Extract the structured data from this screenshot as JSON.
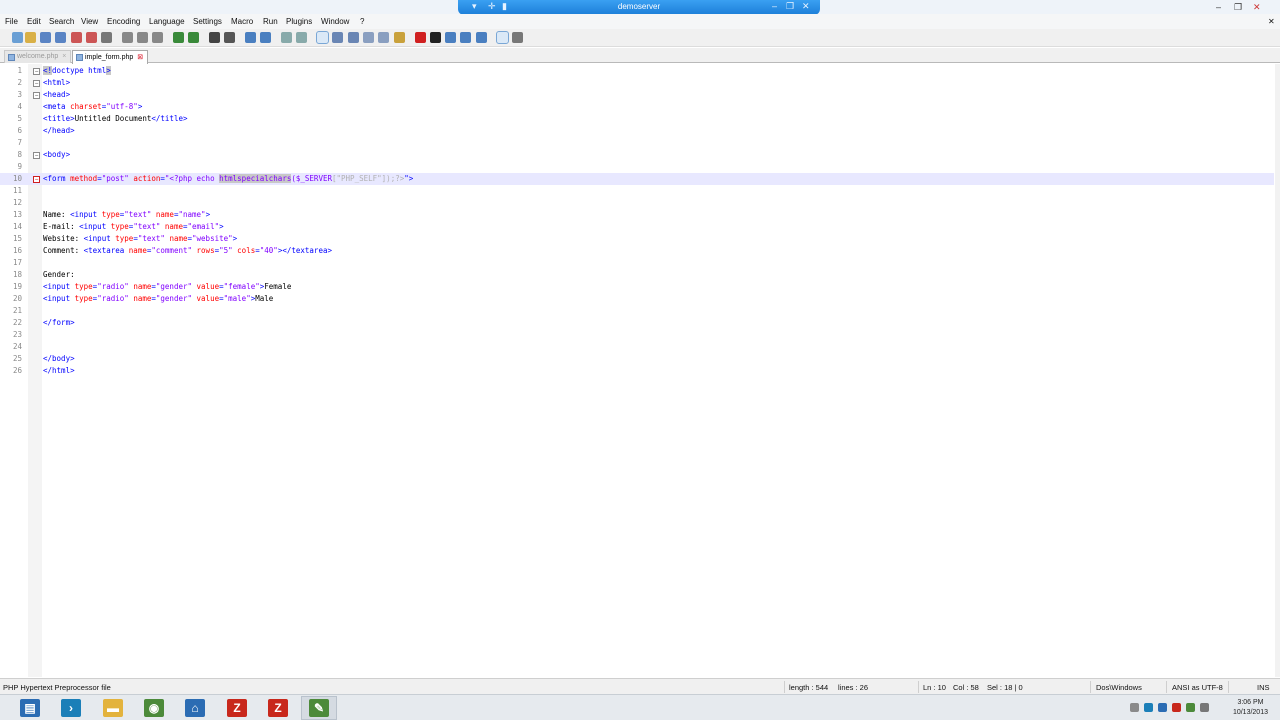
{
  "window": {
    "title": "demoserver"
  },
  "menubar": [
    "File",
    "Edit",
    "Search",
    "View",
    "Encoding",
    "Language",
    "Settings",
    "Macro",
    "Run",
    "Plugins",
    "Window",
    "?"
  ],
  "toolbar": {
    "icons": [
      "new-file-icon",
      "open-file-icon",
      "save-icon",
      "save-all-icon",
      "close-icon",
      "close-all-icon",
      "print-icon",
      "cut-icon",
      "copy-icon",
      "paste-icon",
      "undo-icon",
      "redo-icon",
      "find-icon",
      "replace-icon",
      "zoom-in-icon",
      "zoom-out-icon",
      "sync-vertical-icon",
      "sync-horizontal-icon",
      "word-wrap-icon",
      "show-all-chars-icon",
      "indent-guide-icon",
      "doc-map-icon",
      "function-list-icon",
      "folder-as-workspace-icon",
      "record-macro-icon",
      "stop-macro-icon",
      "play-macro-icon",
      "run-macro-multiple-icon",
      "save-macro-icon",
      "monitor-icon",
      "spellcheck-icon"
    ]
  },
  "tabs": [
    {
      "label": "welcome.php",
      "active": false
    },
    {
      "label": "imple_form.php",
      "active": true
    }
  ],
  "editor": {
    "current_line": 10,
    "lines": [
      {
        "n": "1",
        "fold": "open",
        "segs": [
          {
            "t": "<!",
            "c": "tg hl"
          },
          {
            "t": "doctype html",
            "c": "tg"
          },
          {
            "t": ">",
            "c": "tg hl"
          }
        ]
      },
      {
        "n": "2",
        "fold": "open",
        "segs": [
          {
            "t": "<html>",
            "c": "tg"
          }
        ]
      },
      {
        "n": "3",
        "fold": "open",
        "segs": [
          {
            "t": "<head>",
            "c": "tg"
          }
        ]
      },
      {
        "n": "4",
        "fold": "",
        "segs": [
          {
            "t": "<meta ",
            "c": "tg"
          },
          {
            "t": "charset",
            "c": "at"
          },
          {
            "t": "=",
            "c": "tg"
          },
          {
            "t": "\"utf-8\"",
            "c": "av"
          },
          {
            "t": ">",
            "c": "tg"
          }
        ]
      },
      {
        "n": "5",
        "fold": "",
        "segs": [
          {
            "t": "<title>",
            "c": "tg"
          },
          {
            "t": "Untitled Document",
            "c": "tx"
          },
          {
            "t": "</title>",
            "c": "tg"
          }
        ]
      },
      {
        "n": "6",
        "fold": "",
        "segs": [
          {
            "t": "</head>",
            "c": "tg"
          }
        ]
      },
      {
        "n": "7",
        "fold": "",
        "segs": []
      },
      {
        "n": "8",
        "fold": "open",
        "segs": [
          {
            "t": "<body>",
            "c": "tg"
          }
        ]
      },
      {
        "n": "9",
        "fold": "",
        "segs": []
      },
      {
        "n": "10",
        "fold": "red",
        "segs": [
          {
            "t": "<form ",
            "c": "tg"
          },
          {
            "t": "method",
            "c": "at"
          },
          {
            "t": "=",
            "c": "tg"
          },
          {
            "t": "\"post\" ",
            "c": "av"
          },
          {
            "t": "action",
            "c": "at"
          },
          {
            "t": "=",
            "c": "tg"
          },
          {
            "t": "\"<?php echo ",
            "c": "av"
          },
          {
            "t": "htmlspecialchars",
            "c": "av hl"
          },
          {
            "t": "($",
            "c": "av"
          },
          {
            "t": "_SERVER",
            "c": "av"
          },
          {
            "t": "[\"PHP_SELF\"]);?>",
            "c": "php"
          },
          {
            "t": "\">",
            "c": "tg"
          }
        ]
      },
      {
        "n": "11",
        "fold": "",
        "segs": []
      },
      {
        "n": "12",
        "fold": "",
        "segs": []
      },
      {
        "n": "13",
        "fold": "",
        "segs": [
          {
            "t": "Name: ",
            "c": "tx"
          },
          {
            "t": "<input ",
            "c": "tg"
          },
          {
            "t": "type",
            "c": "at"
          },
          {
            "t": "=",
            "c": "tg"
          },
          {
            "t": "\"text\" ",
            "c": "av"
          },
          {
            "t": "name",
            "c": "at"
          },
          {
            "t": "=",
            "c": "tg"
          },
          {
            "t": "\"name\"",
            "c": "av"
          },
          {
            "t": ">",
            "c": "tg"
          }
        ]
      },
      {
        "n": "14",
        "fold": "",
        "segs": [
          {
            "t": "E-mail: ",
            "c": "tx"
          },
          {
            "t": "<input ",
            "c": "tg"
          },
          {
            "t": "type",
            "c": "at"
          },
          {
            "t": "=",
            "c": "tg"
          },
          {
            "t": "\"text\" ",
            "c": "av"
          },
          {
            "t": "name",
            "c": "at"
          },
          {
            "t": "=",
            "c": "tg"
          },
          {
            "t": "\"email\"",
            "c": "av"
          },
          {
            "t": ">",
            "c": "tg"
          }
        ]
      },
      {
        "n": "15",
        "fold": "",
        "segs": [
          {
            "t": "Website: ",
            "c": "tx"
          },
          {
            "t": "<input ",
            "c": "tg"
          },
          {
            "t": "type",
            "c": "at"
          },
          {
            "t": "=",
            "c": "tg"
          },
          {
            "t": "\"text\" ",
            "c": "av"
          },
          {
            "t": "name",
            "c": "at"
          },
          {
            "t": "=",
            "c": "tg"
          },
          {
            "t": "\"website\"",
            "c": "av"
          },
          {
            "t": ">",
            "c": "tg"
          }
        ]
      },
      {
        "n": "16",
        "fold": "",
        "segs": [
          {
            "t": "Comment: ",
            "c": "tx"
          },
          {
            "t": "<textarea ",
            "c": "tg"
          },
          {
            "t": "name",
            "c": "at"
          },
          {
            "t": "=",
            "c": "tg"
          },
          {
            "t": "\"comment\" ",
            "c": "av"
          },
          {
            "t": "rows",
            "c": "at"
          },
          {
            "t": "=",
            "c": "tg"
          },
          {
            "t": "\"5\" ",
            "c": "av"
          },
          {
            "t": "cols",
            "c": "at"
          },
          {
            "t": "=",
            "c": "tg"
          },
          {
            "t": "\"40\"",
            "c": "av"
          },
          {
            "t": "></textarea>",
            "c": "tg"
          }
        ]
      },
      {
        "n": "17",
        "fold": "",
        "segs": []
      },
      {
        "n": "18",
        "fold": "",
        "segs": [
          {
            "t": "Gender:",
            "c": "tx"
          }
        ]
      },
      {
        "n": "19",
        "fold": "",
        "segs": [
          {
            "t": "<input ",
            "c": "tg"
          },
          {
            "t": "type",
            "c": "at"
          },
          {
            "t": "=",
            "c": "tg"
          },
          {
            "t": "\"radio\" ",
            "c": "av"
          },
          {
            "t": "name",
            "c": "at"
          },
          {
            "t": "=",
            "c": "tg"
          },
          {
            "t": "\"gender\" ",
            "c": "av"
          },
          {
            "t": "value",
            "c": "at"
          },
          {
            "t": "=",
            "c": "tg"
          },
          {
            "t": "\"female\"",
            "c": "av"
          },
          {
            "t": ">",
            "c": "tg"
          },
          {
            "t": "Female",
            "c": "tx"
          }
        ]
      },
      {
        "n": "20",
        "fold": "",
        "segs": [
          {
            "t": "<input ",
            "c": "tg"
          },
          {
            "t": "type",
            "c": "at"
          },
          {
            "t": "=",
            "c": "tg"
          },
          {
            "t": "\"radio\" ",
            "c": "av"
          },
          {
            "t": "name",
            "c": "at"
          },
          {
            "t": "=",
            "c": "tg"
          },
          {
            "t": "\"gender\" ",
            "c": "av"
          },
          {
            "t": "value",
            "c": "at"
          },
          {
            "t": "=",
            "c": "tg"
          },
          {
            "t": "\"male\"",
            "c": "av"
          },
          {
            "t": ">",
            "c": "tg"
          },
          {
            "t": "Male",
            "c": "tx"
          }
        ]
      },
      {
        "n": "21",
        "fold": "",
        "segs": []
      },
      {
        "n": "22",
        "fold": "",
        "segs": [
          {
            "t": "</form>",
            "c": "tg"
          }
        ]
      },
      {
        "n": "23",
        "fold": "",
        "segs": []
      },
      {
        "n": "24",
        "fold": "",
        "segs": []
      },
      {
        "n": "25",
        "fold": "",
        "segs": [
          {
            "t": "</body>",
            "c": "tg"
          }
        ]
      },
      {
        "n": "26",
        "fold": "",
        "segs": [
          {
            "t": "</html>",
            "c": "tg"
          }
        ]
      }
    ]
  },
  "statusbar": {
    "filetype": "PHP Hypertext Preprocessor file",
    "length": "length : 544",
    "lines": "lines : 26",
    "ln": "Ln : 10",
    "col": "Col : 58",
    "sel": "Sel : 18 | 0",
    "eol": "Dos\\Windows",
    "encoding": "ANSI as UTF-8",
    "mode": "INS"
  },
  "taskbar": {
    "apps": [
      "server-manager-icon",
      "powershell-icon",
      "file-explorer-icon",
      "network-icon",
      "remote-desktop-icon",
      "filezilla-server-icon",
      "filezilla-icon",
      "notepad-plus-plus-icon"
    ],
    "colors": {
      "blue": "#2b6cb3",
      "teal": "#1b7fb8",
      "yellow": "#e3b33d",
      "red": "#c8281c",
      "green": "#4c8a3a"
    },
    "clock_time": "3:06 PM",
    "clock_date": "10/13/2013"
  }
}
